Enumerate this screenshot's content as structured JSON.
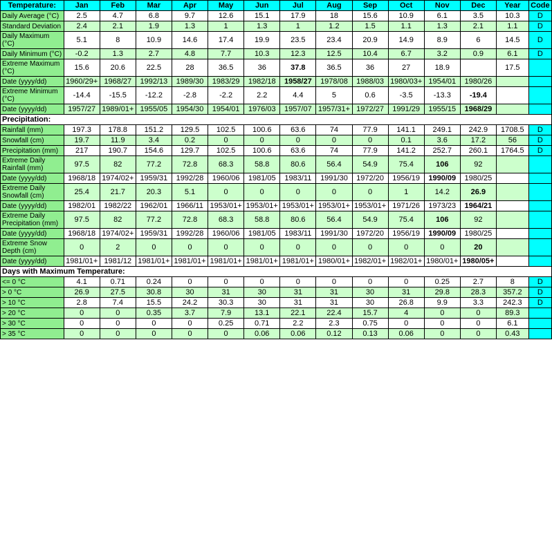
{
  "headers": {
    "temperature": "Temperature:",
    "precipitation": "Precipitation:",
    "days_max_temp": "Days with Maximum Temperature:",
    "columns": [
      "Jan",
      "Feb",
      "Mar",
      "Apr",
      "May",
      "Jun",
      "Jul",
      "Aug",
      "Sep",
      "Oct",
      "Nov",
      "Dec",
      "Year",
      "Code"
    ]
  },
  "temperature_rows": [
    {
      "label": "Daily Average (°C)",
      "values": [
        "2.5",
        "4.7",
        "6.8",
        "9.7",
        "12.6",
        "15.1",
        "17.9",
        "18",
        "15.6",
        "10.9",
        "6.1",
        "3.5",
        "10.3"
      ],
      "code": "D"
    },
    {
      "label": "Standard Deviation",
      "values": [
        "2.4",
        "2.1",
        "1.9",
        "1.3",
        "1",
        "1.3",
        "1",
        "1.2",
        "1.5",
        "1.1",
        "1.3",
        "2.1",
        "1.1"
      ],
      "code": "D"
    },
    {
      "label": "Daily Maximum (°C)",
      "values": [
        "5.1",
        "8",
        "10.9",
        "14.6",
        "17.4",
        "19.9",
        "23.5",
        "23.4",
        "20.9",
        "14.9",
        "8.9",
        "6",
        "14.5"
      ],
      "code": "D"
    },
    {
      "label": "Daily Minimum (°C)",
      "values": [
        "-0.2",
        "1.3",
        "2.7",
        "4.8",
        "7.7",
        "10.3",
        "12.3",
        "12.5",
        "10.4",
        "6.7",
        "3.2",
        "0.9",
        "6.1"
      ],
      "code": "D"
    },
    {
      "label": "Extreme Maximum (°C)",
      "values": [
        "15.6",
        "20.6",
        "22.5",
        "28",
        "36.5",
        "36",
        "37.8",
        "36.5",
        "36",
        "27",
        "18.9",
        "",
        "17.5"
      ],
      "bold_idx": 6,
      "code": ""
    },
    {
      "label": "Date (yyyy/dd)",
      "values": [
        "1960/29+",
        "1968/27",
        "1992/13",
        "1989/30",
        "1983/29",
        "1982/18",
        "1958/27",
        "1978/08",
        "1988/03",
        "1980/03+",
        "1954/01",
        "1980/26",
        ""
      ],
      "bold_idx": 6,
      "code": ""
    },
    {
      "label": "Extreme Minimum (°C)",
      "values": [
        "-14.4",
        "-15.5",
        "-12.2",
        "-2.8",
        "-2.2",
        "2.2",
        "4.4",
        "5",
        "0.6",
        "-3.5",
        "-13.3",
        "-19.4",
        ""
      ],
      "bold_idx": 11,
      "code": ""
    },
    {
      "label": "Date (yyyy/dd)",
      "values": [
        "1957/27",
        "1989/01+",
        "1955/05",
        "1954/30",
        "1954/01",
        "1976/03",
        "1957/07",
        "1957/31+",
        "1972/27",
        "1991/29",
        "1955/15",
        "1968/29",
        ""
      ],
      "bold_idx": 11,
      "code": ""
    }
  ],
  "precipitation_rows": [
    {
      "label": "Rainfall (mm)",
      "values": [
        "197.3",
        "178.8",
        "151.2",
        "129.5",
        "102.5",
        "100.6",
        "63.6",
        "74",
        "77.9",
        "141.1",
        "249.1",
        "242.9",
        "1708.5"
      ],
      "code": "D"
    },
    {
      "label": "Snowfall (cm)",
      "values": [
        "19.7",
        "11.9",
        "3.4",
        "0.2",
        "0",
        "0",
        "0",
        "0",
        "0",
        "0.1",
        "3.6",
        "17.2",
        "56"
      ],
      "code": "D"
    },
    {
      "label": "Precipitation (mm)",
      "values": [
        "217",
        "190.7",
        "154.6",
        "129.7",
        "102.5",
        "100.6",
        "63.6",
        "74",
        "77.9",
        "141.2",
        "252.7",
        "260.1",
        "1764.5"
      ],
      "code": "D"
    },
    {
      "label": "Extreme Daily Rainfall (mm)",
      "values": [
        "97.5",
        "82",
        "77.2",
        "72.8",
        "68.3",
        "58.8",
        "80.6",
        "56.4",
        "54.9",
        "75.4",
        "106",
        "92",
        ""
      ],
      "bold_idx": 10,
      "code": ""
    },
    {
      "label": "Date (yyyy/dd)",
      "values": [
        "1968/18",
        "1974/02+",
        "1959/31",
        "1992/28",
        "1960/06",
        "1981/05",
        "1983/11",
        "1991/30",
        "1972/20",
        "1956/19",
        "1990/09",
        "1980/25",
        ""
      ],
      "bold_idx": 10,
      "code": ""
    },
    {
      "label": "Extreme Daily Snowfall (cm)",
      "values": [
        "25.4",
        "21.7",
        "20.3",
        "5.1",
        "0",
        "0",
        "0",
        "0",
        "0",
        "1",
        "14.2",
        "26.9",
        ""
      ],
      "bold_idx": 11,
      "code": ""
    },
    {
      "label": "Date (yyyy/dd)",
      "values": [
        "1982/01",
        "1982/22",
        "1962/01",
        "1966/11",
        "1953/01+",
        "1953/01+",
        "1953/01+",
        "1953/01+",
        "1953/01+",
        "1971/26",
        "1973/23",
        "1964/21",
        ""
      ],
      "bold_idx": 11,
      "code": ""
    },
    {
      "label": "Extreme Daily Precipitation (mm)",
      "values": [
        "97.5",
        "82",
        "77.2",
        "72.8",
        "68.3",
        "58.8",
        "80.6",
        "56.4",
        "54.9",
        "75.4",
        "106",
        "92",
        ""
      ],
      "bold_idx": 10,
      "code": ""
    },
    {
      "label": "Date (yyyy/dd)",
      "values": [
        "1968/18",
        "1974/02+",
        "1959/31",
        "1992/28",
        "1960/06",
        "1981/05",
        "1983/11",
        "1991/30",
        "1972/20",
        "1956/19",
        "1990/09",
        "1980/25",
        ""
      ],
      "bold_idx": 10,
      "code": ""
    },
    {
      "label": "Extreme Snow Depth (cm)",
      "values": [
        "0",
        "2",
        "0",
        "0",
        "0",
        "0",
        "0",
        "0",
        "0",
        "0",
        "0",
        "20",
        ""
      ],
      "bold_idx": 11,
      "code": ""
    },
    {
      "label": "Date (yyyy/dd)",
      "values": [
        "1981/01+",
        "1981/12",
        "1981/01+",
        "1981/01+",
        "1981/01+",
        "1981/01+",
        "1981/01+",
        "1980/01+",
        "1982/01+",
        "1982/01+",
        "1980/01+",
        "1980/05+",
        ""
      ],
      "bold_idx": 11,
      "code": ""
    }
  ],
  "days_max_temp_rows": [
    {
      "label": "<= 0 °C",
      "values": [
        "4.1",
        "0.71",
        "0.24",
        "0",
        "0",
        "0",
        "0",
        "0",
        "0",
        "0",
        "0.25",
        "2.7",
        "8"
      ],
      "code": "D"
    },
    {
      "label": "> 0 °C",
      "values": [
        "26.9",
        "27.5",
        "30.8",
        "30",
        "31",
        "30",
        "31",
        "31",
        "30",
        "31",
        "29.8",
        "28.3",
        "357.2"
      ],
      "code": "D"
    },
    {
      "label": "> 10 °C",
      "values": [
        "2.8",
        "7.4",
        "15.5",
        "24.2",
        "30.3",
        "30",
        "31",
        "31",
        "30",
        "26.8",
        "9.9",
        "3.3",
        "242.3"
      ],
      "code": "D"
    },
    {
      "label": "> 20 °C",
      "values": [
        "0",
        "0",
        "0.35",
        "3.7",
        "7.9",
        "13.1",
        "22.1",
        "22.4",
        "15.7",
        "4",
        "0",
        "0",
        "89.3"
      ],
      "code": ""
    },
    {
      "label": "> 30 °C",
      "values": [
        "0",
        "0",
        "0",
        "0",
        "0.25",
        "0.71",
        "2.2",
        "2.3",
        "0.75",
        "0",
        "0",
        "0",
        "6.1"
      ],
      "code": ""
    },
    {
      "label": "> 35 °C",
      "values": [
        "0",
        "0",
        "0",
        "0",
        "0",
        "0.06",
        "0.06",
        "0.12",
        "0.13",
        "0.06",
        "0",
        "0",
        "0.43"
      ],
      "code": ""
    }
  ]
}
